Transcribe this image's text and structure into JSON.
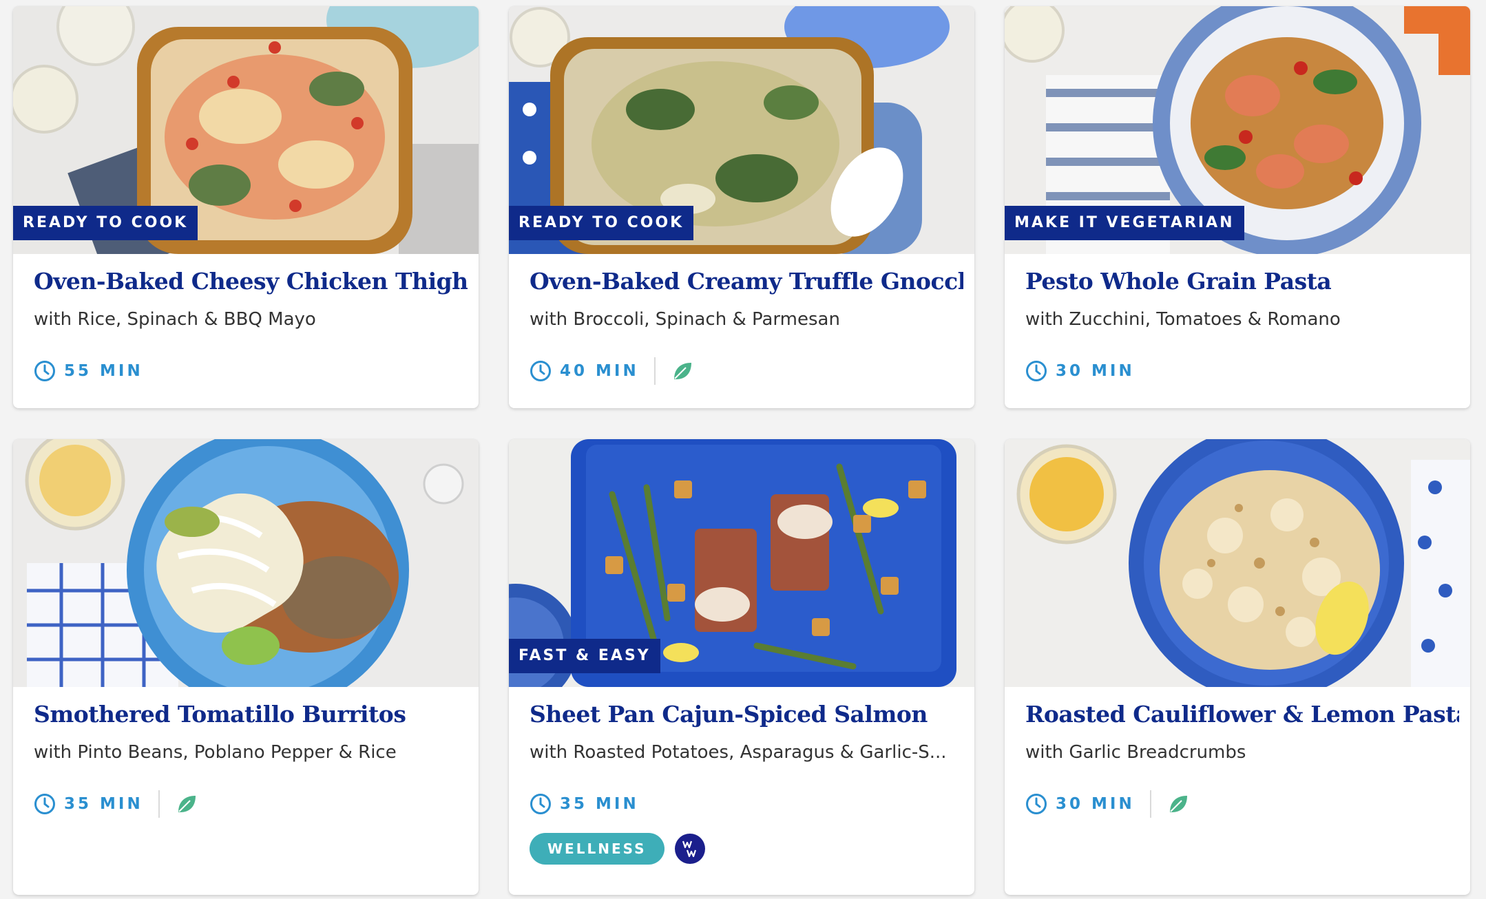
{
  "colors": {
    "brand_navy": "#0f2a8a",
    "time_blue": "#2a8fd0",
    "leaf_green": "#4bb38a",
    "wellness_teal": "#3eaeb8"
  },
  "cards": [
    {
      "tag": "READY TO COOK",
      "title": "Oven-Baked Cheesy Chicken Thighs",
      "subtitle": "with Rice, Spinach & BBQ Mayo",
      "time": "55 MIN",
      "icons": [
        "clock-icon"
      ]
    },
    {
      "tag": "READY TO COOK",
      "title": "Oven-Baked Creamy Truffle Gnocchi",
      "subtitle": "with Broccoli, Spinach & Parmesan",
      "time": "40 MIN",
      "icons": [
        "clock-icon",
        "leaf-icon"
      ]
    },
    {
      "tag": "MAKE IT VEGETARIAN",
      "title": "Pesto Whole Grain Pasta",
      "subtitle": "with Zucchini, Tomatoes & Romano",
      "time": "30 MIN",
      "icons": [
        "clock-icon"
      ]
    },
    {
      "tag": "",
      "title": "Smothered Tomatillo Burritos",
      "subtitle": "with Pinto Beans, Poblano Pepper & Rice",
      "time": "35 MIN",
      "icons": [
        "clock-icon",
        "leaf-icon"
      ]
    },
    {
      "tag": "FAST & EASY",
      "title": "Sheet Pan Cajun-Spiced Salmon",
      "subtitle": "with Roasted Potatoes, Asparagus & Garlic-S...",
      "time": "35 MIN",
      "icons": [
        "clock-icon"
      ],
      "badge": "WELLNESS",
      "badge_icon": "ww-logo-icon"
    },
    {
      "tag": "",
      "title": "Roasted Cauliflower & Lemon Pasta",
      "subtitle": "with Garlic Breadcrumbs",
      "time": "30 MIN",
      "icons": [
        "clock-icon",
        "leaf-icon"
      ]
    }
  ]
}
